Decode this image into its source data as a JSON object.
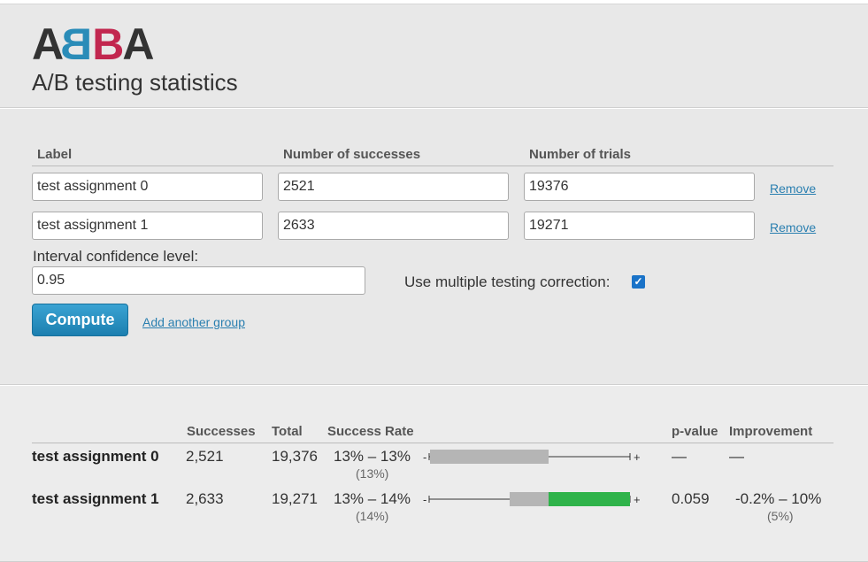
{
  "logo": {
    "letters": [
      "A",
      "B",
      "B",
      "A"
    ],
    "colors": [
      "#333333",
      "#2a8cb8",
      "#c2274f",
      "#333333"
    ]
  },
  "subtitle": "A/B testing statistics",
  "form": {
    "headers": {
      "label": "Label",
      "successes": "Number of successes",
      "trials": "Number of trials"
    },
    "groups": [
      {
        "label": "test assignment 0",
        "successes": "2521",
        "trials": "19376",
        "remove": "Remove"
      },
      {
        "label": "test assignment 1",
        "successes": "2633",
        "trials": "19271",
        "remove": "Remove"
      }
    ],
    "confidence_label": "Interval confidence level:",
    "confidence_value": "0.95",
    "multiple_testing_label": "Use multiple testing correction:",
    "multiple_testing_checked": true,
    "compute_label": "Compute",
    "add_group_label": "Add another group"
  },
  "results": {
    "headers": {
      "successes": "Successes",
      "total": "Total",
      "success_rate": "Success Rate",
      "pvalue": "p-value",
      "improvement": "Improvement"
    },
    "rows": [
      {
        "label": "test assignment 0",
        "successes": "2,521",
        "total": "19,376",
        "rate_range": "13% – 13%",
        "rate_point": "(13%)",
        "pvalue": "—",
        "improvement": "—",
        "improvement_point": "",
        "bar_colors": {
          "left": "#b5b5b5",
          "right": "#b5b5b5"
        }
      },
      {
        "label": "test assignment 1",
        "successes": "2,633",
        "total": "19,271",
        "rate_range": "13% – 14%",
        "rate_point": "(14%)",
        "pvalue": "0.059",
        "improvement": "-0.2% – 10%",
        "improvement_point": "(5%)",
        "bar_colors": {
          "left": "#b5b5b5",
          "right": "#2fb34a"
        }
      }
    ],
    "viz_minus": "-",
    "viz_plus": "+"
  }
}
